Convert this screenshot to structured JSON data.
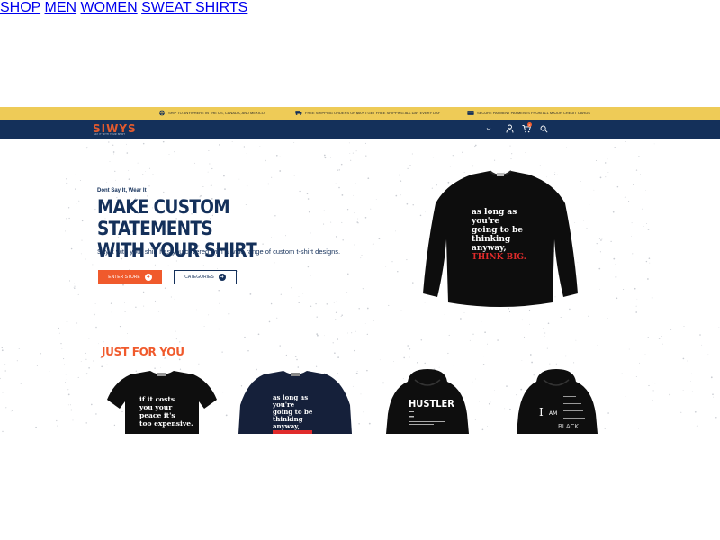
{
  "topbar": {
    "items": [
      {
        "icon": "globe-icon",
        "text": "SHIP TO ANYWHERE IN THE US, CANADA, AND MEXICO"
      },
      {
        "icon": "truck-icon",
        "text": "FREE SHIPPING ORDERS OF $60+ • GET FREE SHIPPING ALL DAY EVERY DAY"
      },
      {
        "icon": "credit-card-icon",
        "text": "SECURE PAYMENT PAYMENTS FROM ALL MAJOR CREDIT CARDS"
      }
    ],
    "color": "#eecb57"
  },
  "nav": {
    "logo": "SIWYS",
    "logo_sub": "SAY IT WITH YOUR SHIRT",
    "links": [
      "SHOP",
      "MEN",
      "WOMEN",
      "SWEAT SHIRTS"
    ],
    "cart_count": "0",
    "color": "#14305a"
  },
  "hero": {
    "eyebrow": "Dont Say It, Wear It",
    "headline_line1": "MAKE CUSTOM STATEMENTS",
    "headline_line2": "WITH YOUR SHIRT",
    "subtext": "Say it with your shirt has you covered with a wide range of custom t-shirt designs.",
    "primary_button": "ENTER STORE",
    "secondary_button": "CATEGORIES",
    "featured_print_white": [
      "as long as",
      "you're",
      "going to be",
      "thinking",
      "anyway,"
    ],
    "featured_print_red": "THINK BIG.",
    "accent": "#f05a2c"
  },
  "section": {
    "title": "JUST FOR YOU"
  },
  "products": [
    {
      "lines": [
        "if it costs",
        "you your",
        "peace it's",
        "too expensive."
      ]
    },
    {
      "lines": [
        "as long as",
        "you're",
        "going to be",
        "thinking",
        "anyway,"
      ]
    },
    {
      "lines": [
        "HUSTLER"
      ]
    },
    {
      "lines": [
        "I",
        "AM",
        "BLACK"
      ]
    }
  ]
}
